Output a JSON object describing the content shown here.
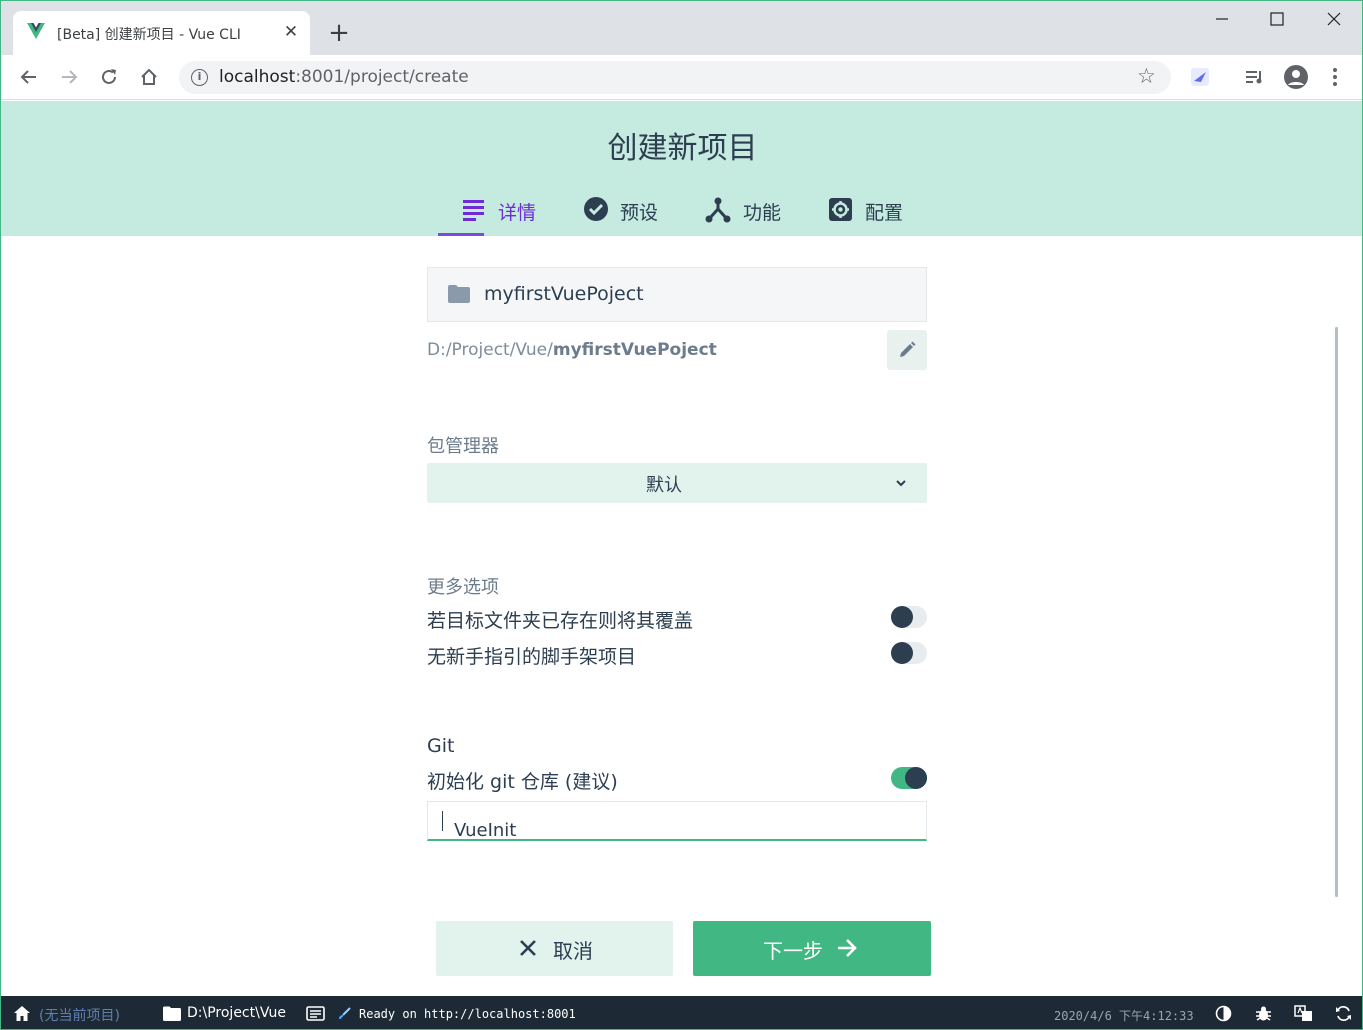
{
  "browser": {
    "tab_title": "[Beta] 创建新项目 - Vue CLI",
    "url_host": "localhost",
    "url_path": ":8001/project/create",
    "window_controls": [
      "minimize-icon",
      "maximize-icon",
      "close-icon"
    ]
  },
  "header": {
    "title": "创建新项目",
    "tabs": [
      {
        "label": "详情",
        "icon": "details-icon",
        "active": true
      },
      {
        "label": "预设",
        "icon": "check-circle-icon",
        "active": false
      },
      {
        "label": "功能",
        "icon": "features-icon",
        "active": false
      },
      {
        "label": "配置",
        "icon": "settings-icon",
        "active": false
      }
    ]
  },
  "form": {
    "project_folder": "myfirstVuePoject",
    "path_prefix": "D:/Project/Vue/",
    "path_name": "myfirstVuePoject",
    "package_manager_label": "包管理器",
    "package_manager_value": "默认",
    "more_options_label": "更多选项",
    "options": [
      {
        "label": "若目标文件夹已存在则将其覆盖",
        "on": false
      },
      {
        "label": "无新手指引的脚手架项目",
        "on": false
      }
    ],
    "git_title": "Git",
    "git_init_label": "初始化 git 仓库 (建议)",
    "git_init_on": true,
    "git_commit_value": "VueInit"
  },
  "buttons": {
    "cancel": "取消",
    "next": "下一步"
  },
  "statusbar": {
    "current_project": "(无当前项目)",
    "folder": "D:\\Project\\Vue",
    "log": "Ready on http://localhost:8001",
    "datetime": "2020/4/6 下午4:12:33"
  },
  "colors": {
    "accent": "#41b883",
    "header_bg": "#c5eae0",
    "active_tab": "#6f2bd6",
    "text": "#2c3e50",
    "statusbar_bg": "#1d2935"
  }
}
